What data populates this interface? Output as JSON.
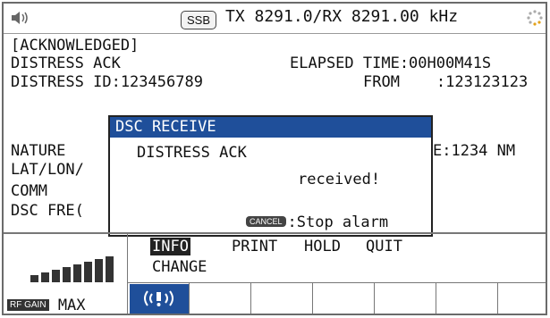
{
  "header": {
    "mode_badge": "SSB",
    "frequency": "TX 8291.0/RX 8291.00 kHz"
  },
  "screen": {
    "status": "[ACKNOWLEDGED]",
    "line1_left": "DISTRESS ACK",
    "line1_right": "ELAPSED TIME:00H00M41S",
    "line2_left": "DISTRESS ID:123456789",
    "line2_right": "FROM    :123123123",
    "nature_label": "NATURE",
    "latlon_label": "LAT/LON/",
    "comm_label": "COMM",
    "dscfreq_label": "DSC FRE(",
    "distance_frag": "E:1234 NM"
  },
  "popup": {
    "title": "DSC RECEIVE",
    "message": "DISTRESS ACK",
    "received": "received!",
    "cancel_key": "CANCEL",
    "cancel_text": ":Stop alarm"
  },
  "menu": {
    "items": [
      "INFO",
      "PRINT",
      "HOLD",
      "QUIT"
    ],
    "second_row": "CHANGE",
    "selected": "INFO"
  },
  "rf_gain": {
    "key": "RF GAIN",
    "value": "MAX"
  },
  "colors": {
    "accent": "#1f4f9a",
    "selected_bg": "#222222"
  },
  "icons": [
    "speaker-icon",
    "busy-spinner-icon",
    "dsc-alarm-icon",
    "signal-bars-icon"
  ]
}
